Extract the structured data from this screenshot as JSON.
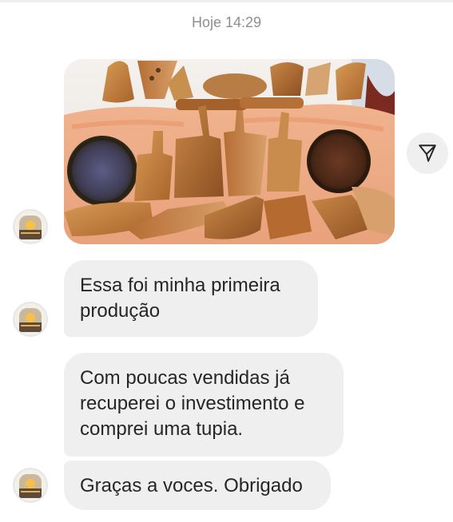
{
  "thread": {
    "timestamp": "Hoje 14:29"
  },
  "photo": {
    "description_icon": "wooden-cutting-boards-photo"
  },
  "share_button": {
    "icon": "send-icon"
  },
  "messages": [
    {
      "text": "Essa foi minha primeira\nprodução"
    },
    {
      "text": "Com poucas vendidas já\nrecuperei o investimento e\ncomprei uma tupia."
    },
    {
      "text": "Graças a voces. Obrigado"
    }
  ],
  "colors": {
    "bubble_bg": "#efefef",
    "timestamp": "#8e8e8e",
    "text": "#262626"
  }
}
